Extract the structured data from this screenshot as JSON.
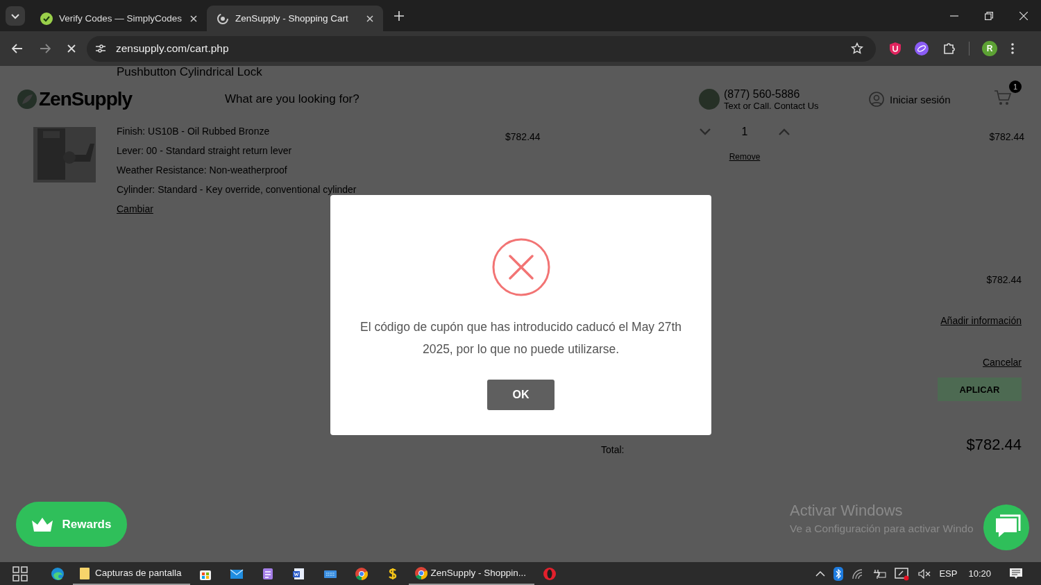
{
  "browser": {
    "tabs": [
      {
        "title": "Verify Codes — SimplyCodes",
        "kind": "simplycodes",
        "selected": false
      },
      {
        "title": "ZenSupply - Shopping Cart",
        "kind": "loading",
        "selected": true
      }
    ],
    "url": "zensupply.com/cart.php",
    "profile_initial": "R"
  },
  "page": {
    "product_title": "Pushbutton Cylindrical Lock",
    "logo": "ZenSupply",
    "search": {
      "placeholder": "What are you looking for?"
    },
    "phone": "(877) 560-5886",
    "phone_note": "Text or Call. Contact Us",
    "sign_in": "Iniciar sesión",
    "cart_count": "1",
    "item": {
      "options": [
        "Finish: US10B - Oil Rubbed Bronze",
        "Lever: 00 - Standard straight return lever",
        "Weather Resistance: Non-weatherproof",
        "Cylinder: Standard - Key override, conventional cylinder"
      ],
      "change_link": "Cambiar",
      "price": "$782.44",
      "quantity": "1",
      "remove_link": "Remove",
      "line_total": "$782.44"
    },
    "summary": {
      "subtotal": "$782.44",
      "add_info_link": "Añadir información",
      "cancel_link": "Cancelar",
      "apply_button": "APLICAR",
      "total_label": "Total:",
      "total": "$782.44"
    }
  },
  "dialog": {
    "kind": "error",
    "message": "El código de cupón que has introducido caducó el May 27th 2025, por lo que no puede utilizarse.",
    "button": "OK"
  },
  "rewards_button": "Rewards",
  "activation_notice": {
    "title": "Activar Windows",
    "text": "Ve a Configuración para activar Windo"
  },
  "taskbar": {
    "apps": [
      {
        "kind": "edge",
        "open": false
      },
      {
        "kind": "folder",
        "label": "Capturas de pantalla",
        "open": true
      },
      {
        "kind": "store",
        "open": false
      },
      {
        "kind": "mail",
        "open": false
      },
      {
        "kind": "notes",
        "open": false
      },
      {
        "kind": "word",
        "open": false
      },
      {
        "kind": "keyboard",
        "open": false
      },
      {
        "kind": "chrome",
        "open": false
      },
      {
        "kind": "dollar",
        "open": false
      },
      {
        "kind": "chrome",
        "label": "ZenSupply - Shoppin...",
        "open": true
      },
      {
        "kind": "opera",
        "open": false
      }
    ],
    "language": "ESP",
    "time": "10:20"
  }
}
